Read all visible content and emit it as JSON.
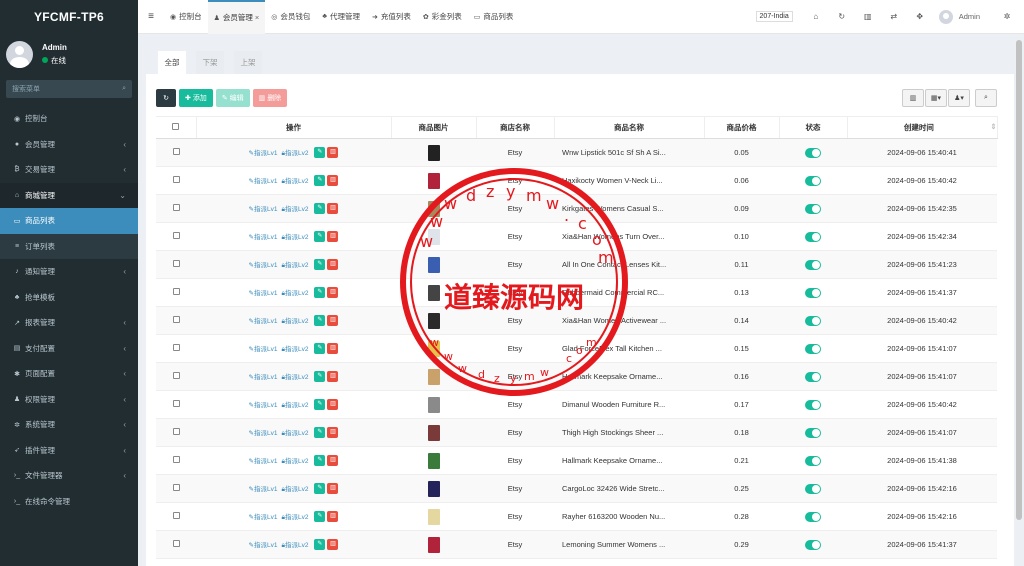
{
  "brand": "YFCMF-TP6",
  "user": {
    "name": "Admin",
    "status": "在线"
  },
  "sidebar": {
    "search_placeholder": "搜索菜单",
    "items": [
      {
        "icon": "dashboard-icon",
        "glyph": "◉",
        "label": "控制台",
        "caret": false,
        "state": ""
      },
      {
        "icon": "member-icon",
        "glyph": "●",
        "label": "会员管理",
        "caret": true,
        "state": ""
      },
      {
        "icon": "bitcoin-icon",
        "glyph": "₿",
        "label": "交易管理",
        "caret": true,
        "state": ""
      },
      {
        "icon": "home-icon",
        "glyph": "⌂",
        "label": "商城管理",
        "caret": true,
        "state": "open"
      },
      {
        "icon": "monitor-icon",
        "glyph": "▭",
        "label": "商品列表",
        "caret": false,
        "state": "active"
      },
      {
        "icon": "list-icon",
        "glyph": "≡",
        "label": "订单列表",
        "caret": false,
        "state": "sub"
      },
      {
        "icon": "bell-icon",
        "glyph": "♪",
        "label": "通知管理",
        "caret": true,
        "state": ""
      },
      {
        "icon": "sitemap-icon",
        "glyph": "♣",
        "label": "抢单模板",
        "caret": false,
        "state": ""
      },
      {
        "icon": "chart-icon",
        "glyph": "↗",
        "label": "报表管理",
        "caret": true,
        "state": ""
      },
      {
        "icon": "card-icon",
        "glyph": "▤",
        "label": "支付配置",
        "caret": true,
        "state": ""
      },
      {
        "icon": "gear-icon",
        "glyph": "✱",
        "label": "页面配置",
        "caret": true,
        "state": ""
      },
      {
        "icon": "users-icon",
        "glyph": "♟",
        "label": "权限管理",
        "caret": true,
        "state": ""
      },
      {
        "icon": "gears-icon",
        "glyph": "✲",
        "label": "系统管理",
        "caret": true,
        "state": ""
      },
      {
        "icon": "rocket-icon",
        "glyph": "➶",
        "label": "插件管理",
        "caret": true,
        "state": ""
      },
      {
        "icon": "terminal-icon",
        "glyph": "›_",
        "label": "文件管理器",
        "caret": true,
        "state": ""
      },
      {
        "icon": "terminal-icon",
        "glyph": "›_",
        "label": "在线命令管理",
        "caret": false,
        "state": ""
      }
    ]
  },
  "topbar": {
    "tabs": [
      {
        "icon": "dashboard-icon",
        "glyph": "◉",
        "label": "控制台",
        "close": false
      },
      {
        "icon": "user-icon",
        "glyph": "♟",
        "label": "会员管理",
        "close": true
      },
      {
        "icon": "wallet-icon",
        "glyph": "◎",
        "label": "会员钱包",
        "close": false
      },
      {
        "icon": "sitemap-icon",
        "glyph": "♣",
        "label": "代理管理",
        "close": false
      },
      {
        "icon": "login-icon",
        "glyph": "➜",
        "label": "充值列表",
        "close": false
      },
      {
        "icon": "gift-icon",
        "glyph": "✿",
        "label": "彩金列表",
        "close": false
      },
      {
        "icon": "monitor-icon",
        "glyph": "▭",
        "label": "商品列表",
        "close": false
      }
    ],
    "country": "207-India",
    "admin": "Admin"
  },
  "filter_tabs": [
    "全部",
    "下架",
    "上架"
  ],
  "toolbar": {
    "add": "添加",
    "edit": "编辑",
    "delete": "删除"
  },
  "table": {
    "headers": [
      "操作",
      "商品图片",
      "商店名称",
      "商品名称",
      "商品价格",
      "状态",
      "创建时间"
    ],
    "action_links": [
      "指派Lv1",
      "指派Lv2"
    ],
    "rows": [
      {
        "shop": "Etsy",
        "name": "Wnw Lipstick 501c Sf Sh A Si...",
        "price": "0.05",
        "time": "2024-09-06 15:40:41",
        "color": "#222"
      },
      {
        "shop": "Etsy",
        "name": "Haxikocty Women V-Neck Li...",
        "price": "0.06",
        "time": "2024-09-06 15:40:42",
        "color": "#b0233a"
      },
      {
        "shop": "Etsy",
        "name": "Kirkgates Womens Casual S...",
        "price": "0.09",
        "time": "2024-09-06 15:42:35",
        "color": "#a58a5e"
      },
      {
        "shop": "Etsy",
        "name": "Xia&Han Womens Turn Over...",
        "price": "0.10",
        "time": "2024-09-06 15:42:34",
        "color": "#dfe3ea"
      },
      {
        "shop": "Etsy",
        "name": "All In One Contact Lenses Kit...",
        "price": "0.11",
        "time": "2024-09-06 15:41:23",
        "color": "#3a5fb0"
      },
      {
        "shop": "Etsy",
        "name": "Rubbermaid Commercial RC...",
        "price": "0.13",
        "time": "2024-09-06 15:41:37",
        "color": "#444"
      },
      {
        "shop": "Etsy",
        "name": "Xia&Han Women Activewear ...",
        "price": "0.14",
        "time": "2024-09-06 15:40:42",
        "color": "#2a2a2a"
      },
      {
        "shop": "Etsy",
        "name": "Glad ForceFlex Tall Kitchen ...",
        "price": "0.15",
        "time": "2024-09-06 15:41:07",
        "color": "#e5c34a"
      },
      {
        "shop": "Etsy",
        "name": "Hallmark Keepsake Orname...",
        "price": "0.16",
        "time": "2024-09-06 15:41:07",
        "color": "#c9a16b"
      },
      {
        "shop": "Etsy",
        "name": "Dimanul Wooden Furniture R...",
        "price": "0.17",
        "time": "2024-09-06 15:40:42",
        "color": "#8a8a8a"
      },
      {
        "shop": "Etsy",
        "name": "Thigh High Stockings Sheer ...",
        "price": "0.18",
        "time": "2024-09-06 15:41:07",
        "color": "#7a3a3a"
      },
      {
        "shop": "Etsy",
        "name": "Hallmark Keepsake Orname...",
        "price": "0.21",
        "time": "2024-09-06 15:41:38",
        "color": "#3a7a3a"
      },
      {
        "shop": "Etsy",
        "name": "CargoLoc 32426 Wide Stretc...",
        "price": "0.25",
        "time": "2024-09-06 15:42:16",
        "color": "#24245a"
      },
      {
        "shop": "Etsy",
        "name": "Rayher 6163200 Wooden Nu...",
        "price": "0.28",
        "time": "2024-09-06 15:42:16",
        "color": "#e5d7a0"
      },
      {
        "shop": "Etsy",
        "name": "Lemoning Summer Womens ...",
        "price": "0.29",
        "time": "2024-09-06 15:41:37",
        "color": "#b0233a"
      }
    ]
  },
  "watermark": {
    "title": "道臻源码网",
    "letters": "wwwdzymw.com"
  }
}
